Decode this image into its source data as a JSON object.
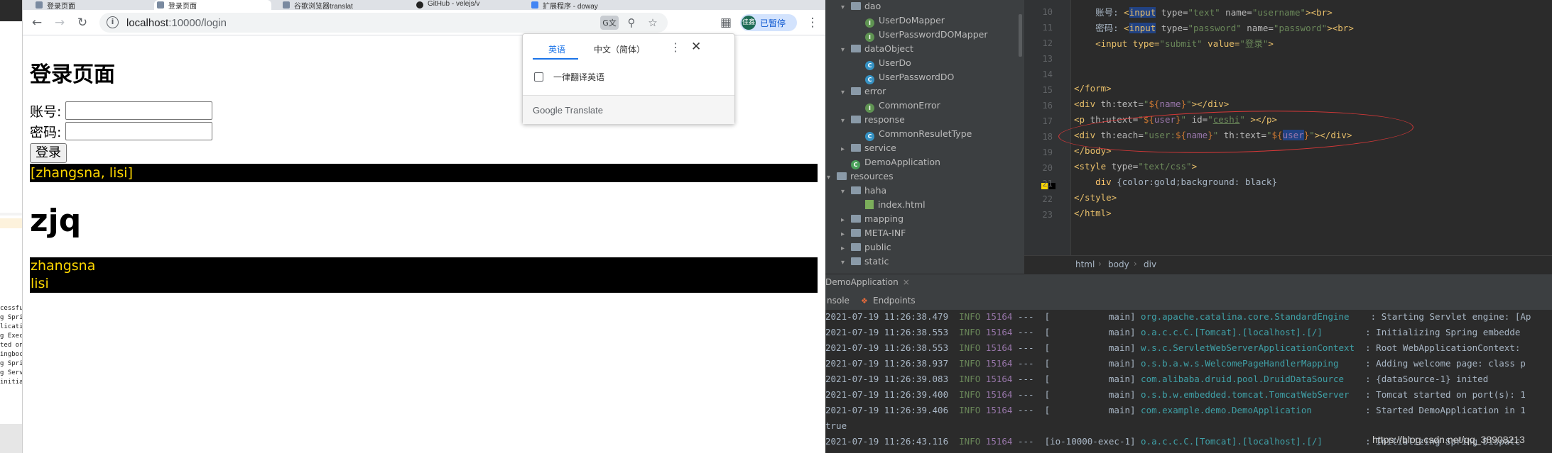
{
  "left_strip": {
    "lines": [
      "cessfu",
      "g Spri",
      "licati",
      "g Exec",
      "ted on",
      "ingboc",
      "g Spri",
      "g Serv",
      "initia"
    ]
  },
  "browser": {
    "tabs": [
      {
        "label": "登录页面"
      },
      {
        "label": "登录页面"
      },
      {
        "label": "谷歌浏览器translat"
      },
      {
        "label": "GitHub - velejs/v"
      },
      {
        "label": "扩展程序 - doway"
      }
    ],
    "url_host": "localhost",
    "url_rest": ":10000/login",
    "profile_label": "已暂停",
    "profile_avatar": "佳鑫",
    "icons": {
      "back": "arrow-left-icon",
      "forward": "arrow-right-icon",
      "reload": "reload-icon",
      "translate": "translate-icon",
      "zoom": "zoom-icon",
      "bookmark": "star-icon",
      "extensions": "puzzle-icon",
      "menu": "kebab-menu-icon"
    }
  },
  "page": {
    "title": "登录页面",
    "username_label": "账号:",
    "password_label": "密码:",
    "login_button": "登录",
    "user_list": "[zhangsna, lisi]",
    "heading": "zjq",
    "names": [
      "zhangsna",
      "lisi"
    ],
    "colors": {
      "gold": "#ffd700",
      "black": "#000000"
    }
  },
  "translate_popup": {
    "tab_english": "英语",
    "tab_chinese": "中文（简体）",
    "always_translate": "一律翻译英语",
    "footer": "Google Translate"
  },
  "ide": {
    "tree": [
      {
        "label": "dao",
        "type": "folder",
        "indent": 1,
        "expanded": true
      },
      {
        "label": "UserDoMapper",
        "type": "interface",
        "indent": 2
      },
      {
        "label": "UserPasswordDOMapper",
        "type": "interface",
        "indent": 2
      },
      {
        "label": "dataObject",
        "type": "folder",
        "indent": 1,
        "expanded": true
      },
      {
        "label": "UserDo",
        "type": "class",
        "indent": 2
      },
      {
        "label": "UserPasswordDO",
        "type": "class",
        "indent": 2
      },
      {
        "label": "error",
        "type": "folder",
        "indent": 1,
        "expanded": true
      },
      {
        "label": "CommonError",
        "type": "interface",
        "indent": 2
      },
      {
        "label": "response",
        "type": "folder",
        "indent": 1,
        "expanded": true
      },
      {
        "label": "CommonResuletType",
        "type": "class",
        "indent": 2
      },
      {
        "label": "service",
        "type": "folder",
        "indent": 1,
        "expanded": false
      },
      {
        "label": "DemoApplication",
        "type": "spring",
        "indent": 1
      },
      {
        "label": "resources",
        "type": "folder",
        "indent": 0,
        "expanded": true
      },
      {
        "label": "haha",
        "type": "folder",
        "indent": 1,
        "expanded": true
      },
      {
        "label": "index.html",
        "type": "html",
        "indent": 2
      },
      {
        "label": "mapping",
        "type": "folder",
        "indent": 1,
        "expanded": false
      },
      {
        "label": "META-INF",
        "type": "folder",
        "indent": 1,
        "expanded": false
      },
      {
        "label": "public",
        "type": "folder",
        "indent": 1,
        "expanded": false
      },
      {
        "label": "static",
        "type": "folder",
        "indent": 1,
        "expanded": true
      }
    ],
    "line_numbers": [
      "10",
      "11",
      "12",
      "13",
      "14",
      "15",
      "16",
      "17",
      "18",
      "19",
      "20",
      "21",
      "22",
      "23"
    ],
    "code": {
      "l10_label": "账号:",
      "l10": [
        "<",
        "input",
        " type=",
        "\"text\"",
        " name=",
        "\"username\"",
        "><",
        "br",
        ">"
      ],
      "l11_label": "密码:",
      "l11": [
        "<",
        "input",
        " type=",
        "\"password\"",
        " name=",
        "\"password\"",
        "><",
        "br",
        ">"
      ],
      "l12": [
        "<input type=",
        "\"submit\"",
        " value=",
        "\"登录\"",
        ">"
      ],
      "l15": "</form>",
      "l16": [
        "<div ",
        "th:text=",
        "\"",
        "${",
        "name",
        "}",
        "\"",
        "></div>"
      ],
      "l17": [
        "<p ",
        "th:utext=",
        "\"",
        "${",
        "user",
        "}",
        "\"",
        " id=",
        "\"",
        "ceshi",
        "\"",
        " ></p>"
      ],
      "l18": [
        "<div ",
        "th:each=",
        "\"user:",
        "${",
        "name",
        "}",
        "\"",
        " th:text=",
        "\"",
        "${",
        "user",
        "}",
        "\"",
        "></div>"
      ],
      "l19": "</body>",
      "l20": [
        "<style ",
        "type=",
        "\"text/css\"",
        ">"
      ],
      "l21": [
        "div ",
        "{color:gold;background: black}"
      ],
      "l22": "</style>",
      "l23": "</html>"
    },
    "breadcrumbs": [
      "html",
      "body",
      "div"
    ],
    "run_tab": "DemoApplication",
    "subtabs": [
      "nsole",
      "Endpoints"
    ],
    "console": [
      {
        "ts": "2021-07-19 11:26:38.479",
        "lvl": "INFO",
        "pid": "15164",
        "thread": "---  [           main]",
        "logger": "org.apache.catalina.core.StandardEngine  ",
        "msg": ": Starting Servlet engine: [Ap"
      },
      {
        "ts": "2021-07-19 11:26:38.553",
        "lvl": "INFO",
        "pid": "15164",
        "thread": "---  [           main]",
        "logger": "o.a.c.c.C.[Tomcat].[localhost].[/]      ",
        "msg": ": Initializing Spring embedde"
      },
      {
        "ts": "2021-07-19 11:26:38.553",
        "lvl": "INFO",
        "pid": "15164",
        "thread": "---  [           main]",
        "logger": "w.s.c.ServletWebServerApplicationContext",
        "msg": ": Root WebApplicationContext:"
      },
      {
        "ts": "2021-07-19 11:26:38.937",
        "lvl": "INFO",
        "pid": "15164",
        "thread": "---  [           main]",
        "logger": "o.s.b.a.w.s.WelcomePageHandlerMapping   ",
        "msg": ": Adding welcome page: class p"
      },
      {
        "ts": "2021-07-19 11:26:39.083",
        "lvl": "INFO",
        "pid": "15164",
        "thread": "---  [           main]",
        "logger": "com.alibaba.druid.pool.DruidDataSource  ",
        "msg": ": {dataSource-1} inited"
      },
      {
        "ts": "2021-07-19 11:26:39.400",
        "lvl": "INFO",
        "pid": "15164",
        "thread": "---  [           main]",
        "logger": "o.s.b.w.embedded.tomcat.TomcatWebServer ",
        "msg": ": Tomcat started on port(s): 1"
      },
      {
        "ts": "2021-07-19 11:26:39.406",
        "lvl": "INFO",
        "pid": "15164",
        "thread": "---  [           main]",
        "logger": "com.example.demo.DemoApplication        ",
        "msg": ": Started DemoApplication in 1"
      },
      {
        "plain": "true"
      },
      {
        "ts": "2021-07-19 11:26:43.116",
        "lvl": "INFO",
        "pid": "15164",
        "thread": "---  [io-10000-exec-1]",
        "logger": "o.a.c.c.C.[Tomcat].[localhost].[/]      ",
        "msg": ": Initializing Spring Dispatc"
      }
    ],
    "watermark": "https://blog.csdn.net/qq_38908213"
  }
}
